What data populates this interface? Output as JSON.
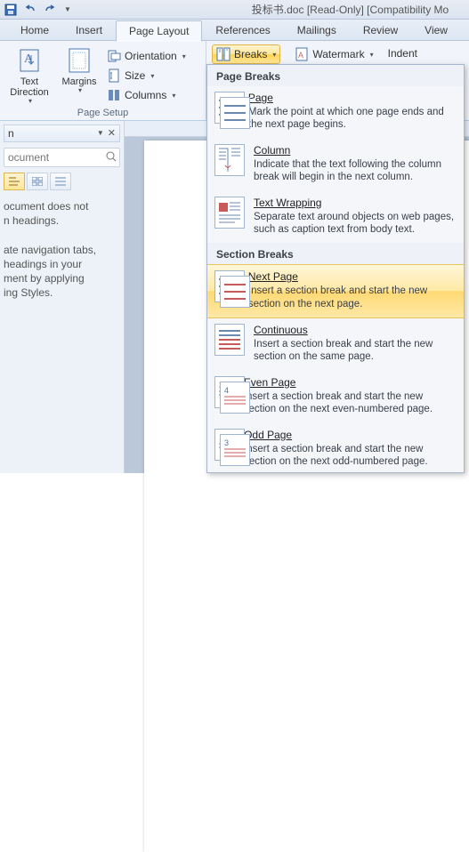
{
  "title": "投标书.doc [Read-Only] [Compatibility Mo",
  "tabs": {
    "home": "Home",
    "insert": "Insert",
    "page_layout": "Page Layout",
    "references": "References",
    "mailings": "Mailings",
    "review": "Review",
    "view": "View"
  },
  "ribbon": {
    "text_direction": "Text\nDirection",
    "margins": "Margins",
    "orientation": "Orientation",
    "size": "Size",
    "columns": "Columns",
    "breaks": "Breaks",
    "watermark": "Watermark",
    "indent": "Indent",
    "page_setup": "Page Setup"
  },
  "nav": {
    "title": "n",
    "placeholder": "ocument",
    "msg1": "ocument does not\nn headings.",
    "msg2": "ate navigation tabs,\n headings in your\nment by applying\ning Styles."
  },
  "menu": {
    "header1": "Page Breaks",
    "header2": "Section Breaks",
    "page": {
      "title": "Page",
      "desc": "Mark the point at which one page ends and the next page begins."
    },
    "column": {
      "title": "Column",
      "desc": "Indicate that the text following the column break will begin in the next column."
    },
    "textwrap": {
      "title": "Text Wrapping",
      "desc": "Separate text around objects on web pages, such as caption text from body text."
    },
    "nextpage": {
      "title": "Next Page",
      "desc": "Insert a section break and start the new section on the next page."
    },
    "continuous": {
      "title": "Continuous",
      "desc": "Insert a section break and start the new section on the same page."
    },
    "evenpage": {
      "title": "Even Page",
      "desc": "Insert a section break and start the new section on the next even-numbered page."
    },
    "oddpage": {
      "title": "Odd Page",
      "desc": "Insert a section break and start the new section on the next odd-numbered page."
    }
  }
}
